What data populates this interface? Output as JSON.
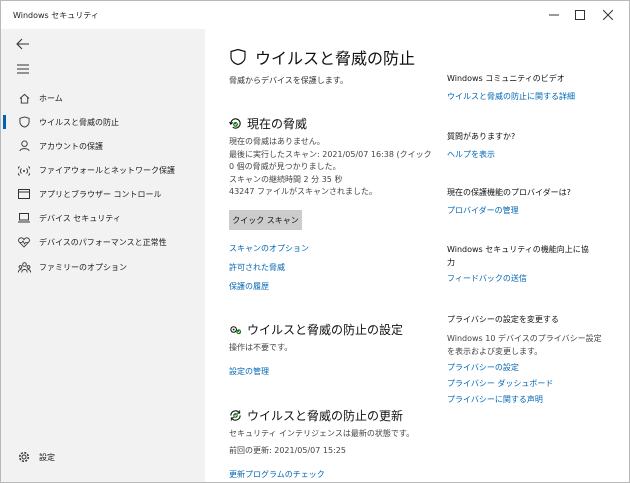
{
  "window": {
    "title": "Windows セキュリティ"
  },
  "sidebar": {
    "items": [
      {
        "label": "ホーム",
        "icon": "home-icon"
      },
      {
        "label": "ウイルスと脅威の防止",
        "icon": "shield-icon"
      },
      {
        "label": "アカウントの保護",
        "icon": "person-icon"
      },
      {
        "label": "ファイアウォールとネットワーク保護",
        "icon": "wifi-icon"
      },
      {
        "label": "アプリとブラウザー コントロール",
        "icon": "app-browser-icon"
      },
      {
        "label": "デバイス セキュリティ",
        "icon": "laptop-icon"
      },
      {
        "label": "デバイスのパフォーマンスと正常性",
        "icon": "heart-icon"
      },
      {
        "label": "ファミリーのオプション",
        "icon": "family-icon"
      }
    ],
    "settings_label": "設定"
  },
  "main": {
    "title": "ウイルスと脅威の防止",
    "subtitle": "脅威からデバイスを保護します。",
    "threats": {
      "heading": "現在の脅威",
      "line1": "現在の脅威はありません。",
      "line2": "最後に実行したスキャン: 2021/05/07 16:38 (クイック",
      "line3": "0 個の脅威が見つかりました。",
      "line4": "スキャンの継続時間 2 分 35 秒",
      "line5": "43247 ファイルがスキャンされました。",
      "button": "クイック スキャン",
      "links": [
        "スキャンのオプション",
        "許可された脅威",
        "保護の履歴"
      ]
    },
    "settings": {
      "heading": "ウイルスと脅威の防止の設定",
      "status": "操作は不要です。",
      "link": "設定の管理"
    },
    "updates": {
      "heading": "ウイルスと脅威の防止の更新",
      "status": "セキュリティ インテリジェンスは最新の状態です。",
      "last": "前回の更新: 2021/05/07 15:25",
      "link": "更新プログラムのチェック"
    }
  },
  "right": {
    "community": {
      "heading": "Windows コミュニティのビデオ",
      "link": "ウイルスと脅威の防止に関する詳細"
    },
    "question": {
      "heading": "質問がありますか?",
      "link": "ヘルプを表示"
    },
    "provider": {
      "heading": "現在の保護機能のプロバイダーは?",
      "link": "プロバイダーの管理"
    },
    "improve": {
      "heading_line1": "Windows セキュリティの機能向上に協",
      "heading_line2": "力",
      "link": "フィードバックの送信"
    },
    "privacy": {
      "heading": "プライバシーの設定を変更する",
      "text_line1": "Windows 10 デバイスのプライバシー設定",
      "text_line2": "を表示および変更します。",
      "links": [
        "プライバシーの設定",
        "プライバシー ダッシュボード",
        "プライバシーに関する声明"
      ]
    }
  },
  "colors": {
    "accent": "#0066b4",
    "sidebar_bg": "#f2f2f2",
    "button_bg": "#cccccc",
    "ok_green": "#107c10"
  }
}
